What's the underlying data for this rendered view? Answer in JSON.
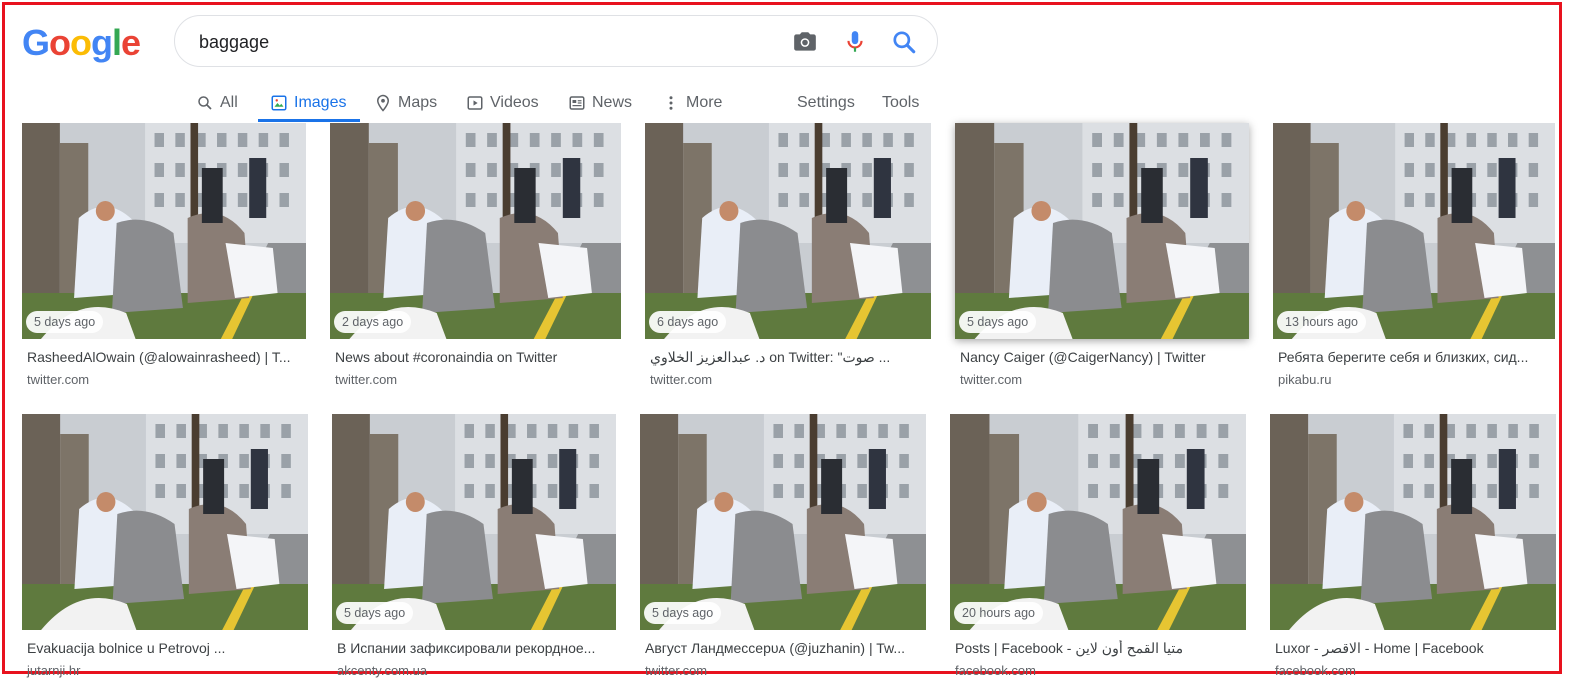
{
  "logo": [
    "G",
    "o",
    "o",
    "g",
    "l",
    "e"
  ],
  "logo_colors": [
    "#4285f4",
    "#ea4335",
    "#fbbc05",
    "#4285f4",
    "#34a853",
    "#ea4335"
  ],
  "search": {
    "value": "baggage"
  },
  "tabs": [
    {
      "label": "All",
      "icon": "search-icon",
      "active": false
    },
    {
      "label": "Images",
      "icon": "image-icon",
      "active": true
    },
    {
      "label": "Maps",
      "icon": "map-pin-icon",
      "active": false
    },
    {
      "label": "Videos",
      "icon": "play-icon",
      "active": false
    },
    {
      "label": "News",
      "icon": "news-icon",
      "active": false
    },
    {
      "label": "More",
      "icon": "more-dots-icon",
      "active": false
    }
  ],
  "tools": {
    "settings": "Settings",
    "tools": "Tools"
  },
  "colors": {
    "accent": "#1a73e8",
    "border": "#e8121e"
  },
  "results": [
    {
      "age": "5 days ago",
      "title": "RasheedAlOwain (@alowainrasheed) | T...",
      "domain": "twitter.com"
    },
    {
      "age": "2 days ago",
      "title": "News about #coronaindia on Twitter",
      "domain": "twitter.com"
    },
    {
      "age": "6 days ago",
      "title": "د. عبدالعزيز الخلاوي on Twitter: \"صوت ...",
      "domain": "twitter.com"
    },
    {
      "age": "5 days ago",
      "title": "Nancy Caiger (@CaigerNancy) | Twitter",
      "domain": "twitter.com"
    },
    {
      "age": "13 hours ago",
      "title": "Ребята берегите себя и близких, сид...",
      "domain": "pikabu.ru"
    },
    {
      "age": "",
      "title": "Evakuacija bolnice u Petrovoj ...",
      "domain": "jutarnji.hr"
    },
    {
      "age": "5 days ago",
      "title": "В Испании зафиксировали рекордное...",
      "domain": "akcenty.com.ua"
    },
    {
      "age": "5 days ago",
      "title": "Август Ландмессерᴜᴀ (@juzhanin) | Tw...",
      "domain": "twitter.com"
    },
    {
      "age": "20 hours ago",
      "title": "Posts | Facebook - متيا القمح أون لاين",
      "domain": "facebook.com"
    },
    {
      "age": "",
      "title": "Luxor - الاقصر - Home | Facebook",
      "domain": "facebook.com"
    }
  ]
}
